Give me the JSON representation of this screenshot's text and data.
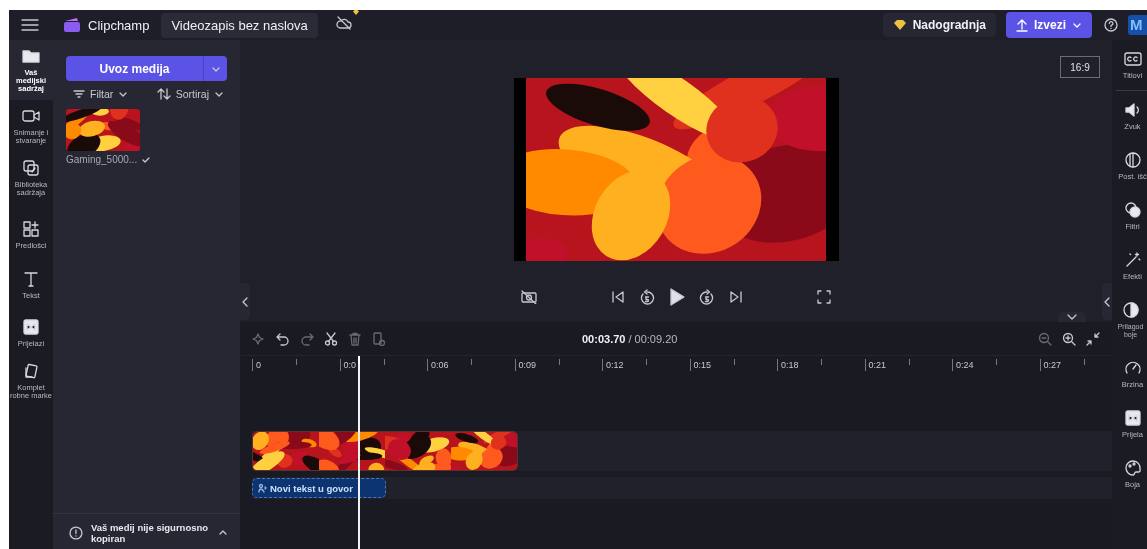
{
  "topbar": {
    "app_name": "Clipchamp",
    "title": "Videozapis bez naslova",
    "upgrade": "Nadogradnja",
    "export": "Izvezi",
    "avatar": "M"
  },
  "left_rail": [
    {
      "label": "Vaš medijski sadržaj",
      "kind": "folder",
      "selected": true
    },
    {
      "label": "Snimanje i stvaranje",
      "kind": "camera",
      "selected": false
    },
    {
      "label": "Biblioteka sadržaja",
      "kind": "library",
      "selected": false
    },
    {
      "label": "Predlošci",
      "kind": "templates",
      "selected": false
    },
    {
      "label": "Tekst",
      "kind": "text",
      "selected": false
    },
    {
      "label": "Prijelazi",
      "kind": "transition",
      "selected": false
    },
    {
      "label": "Komplet robne marke",
      "kind": "brand",
      "selected": false
    }
  ],
  "media_panel": {
    "import_button": "Uvoz medija",
    "filter": "Filtar",
    "sort": "Sortiraj",
    "items": [
      {
        "name": "Gaming_5000...",
        "kind": "picture"
      }
    ],
    "backup_notice": "Vaš medij nije sigurnosno kopiran"
  },
  "preview": {
    "aspect": "16:9",
    "kind": "picture"
  },
  "timeline": {
    "current": "00:03.70",
    "total": "/ 00:09.20",
    "ruler": [
      "0",
      "0:0",
      "0:06",
      "0:09",
      "0:12",
      "0:15",
      "0:18",
      "0:21",
      "0:24",
      "0:27"
    ],
    "text_clip": "Novi tekst u govor"
  },
  "right_rail": [
    {
      "label": "Titlovi",
      "kind": "cc"
    },
    {
      "label": "Zvuk",
      "kind": "sound"
    },
    {
      "label": "Post. išč",
      "kind": "fade"
    },
    {
      "label": "Filtri",
      "kind": "filters"
    },
    {
      "label": "Efekti",
      "kind": "effects"
    },
    {
      "label": "Prilagod boje",
      "kind": "adjust"
    },
    {
      "label": "Brzina",
      "kind": "speed"
    },
    {
      "label": "Prijela",
      "kind": "transition"
    },
    {
      "label": "Boja",
      "kind": "palette"
    }
  ]
}
